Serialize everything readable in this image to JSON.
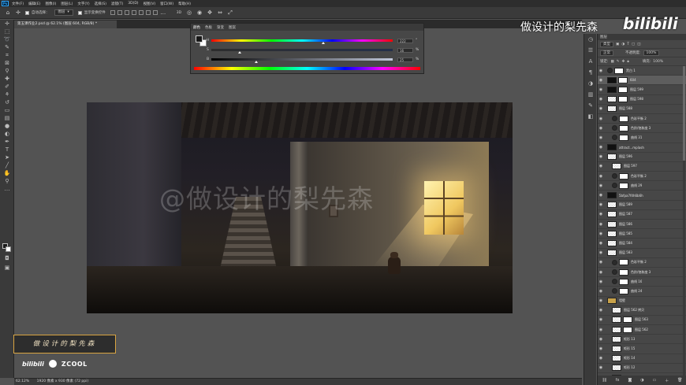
{
  "menubar": {
    "logo": "Ps",
    "items": [
      "文件(F)",
      "编辑(E)",
      "图像(I)",
      "图层(L)",
      "文字(Y)",
      "选择(S)",
      "滤镜(T)",
      "3D(D)",
      "视图(V)",
      "窗口(W)",
      "帮助(H)"
    ]
  },
  "options": {
    "auto_select_label": "自动选择：",
    "auto_select_value": "图层",
    "show_transform_label": "显示变换控件"
  },
  "document": {
    "tab_title": "第五课作业2.psd @ 62.1% (图层 604, RGB/8) *"
  },
  "color_panel": {
    "tabs": [
      "颜色",
      "色板",
      "渐变",
      "图案"
    ],
    "active_tab": "颜色",
    "channels": [
      {
        "label": "H",
        "value": "222",
        "unit": "°",
        "position": 0.62,
        "gradient": "linear-gradient(90deg,#f00,#ff0,#0f0,#0ff,#00f,#f0f,#f00)"
      },
      {
        "label": "S",
        "value": "16",
        "unit": "%",
        "position": 0.16,
        "gradient": "linear-gradient(90deg,#2d2d2d,#24304a)"
      },
      {
        "label": "B",
        "value": "25",
        "unit": "%",
        "position": 0.25,
        "gradient": "linear-gradient(90deg,#000,#bfc6d8)"
      }
    ]
  },
  "canvas": {
    "watermark": "@做设计的梨先森"
  },
  "badge": {
    "text": "做设计的梨先森",
    "bili": "bilibili",
    "zcool": "ZCOOL"
  },
  "status": {
    "zoom": "62.12%",
    "doc_size": "1920 像素 x 930 像素 (72 ppi)"
  },
  "overlay": {
    "author": "做设计的梨先森",
    "bilibili": "bilibili"
  },
  "layers_panel": {
    "tabs": [
      "图层"
    ],
    "filter_label": "类型",
    "mode": "正常",
    "opacity_label": "不透明度:",
    "opacity_value": "100%",
    "lock_label": "锁定:",
    "fill_label": "填充:",
    "fill_value": "100%",
    "layers": [
      {
        "name": "黑白 1",
        "type": "adj",
        "indent": false,
        "mask": true,
        "selected": false
      },
      {
        "name": "604",
        "type": "dark",
        "indent": false,
        "mask": true,
        "selected": true
      },
      {
        "name": "图层 599",
        "type": "dark",
        "indent": false,
        "mask": true,
        "selected": false
      },
      {
        "name": "图层 598",
        "type": "normal",
        "indent": false,
        "mask": true,
        "selected": false
      },
      {
        "name": "图层 588",
        "type": "normal",
        "indent": false,
        "mask": false,
        "selected": false
      },
      {
        "name": "色彩平衡 2",
        "type": "adj",
        "indent": true,
        "mask": true,
        "selected": false
      },
      {
        "name": "色阶/饱和度 3",
        "type": "adj",
        "indent": true,
        "mask": true,
        "selected": false
      },
      {
        "name": "曲线 31",
        "type": "adj",
        "indent": true,
        "mask": true,
        "selected": false
      },
      {
        "name": "attract...mplash",
        "type": "dark",
        "indent": false,
        "mask": false,
        "selected": false
      },
      {
        "name": "图层 596",
        "type": "normal",
        "indent": false,
        "mask": false,
        "selected": false
      },
      {
        "name": "图层 597",
        "type": "normal",
        "indent": true,
        "mask": false,
        "selected": false
      },
      {
        "name": "色彩平衡 2",
        "type": "adj",
        "indent": true,
        "mask": true,
        "selected": false
      },
      {
        "name": "曲线 29",
        "type": "adj",
        "indent": true,
        "mask": true,
        "selected": false
      },
      {
        "name": "5bfpa7f4h6b6h",
        "type": "dark",
        "indent": false,
        "mask": false,
        "selected": false
      },
      {
        "name": "图层 589",
        "type": "normal",
        "indent": false,
        "mask": false,
        "selected": false
      },
      {
        "name": "图层 587",
        "type": "normal",
        "indent": false,
        "mask": false,
        "selected": false
      },
      {
        "name": "图层 586",
        "type": "normal",
        "indent": false,
        "mask": false,
        "selected": false
      },
      {
        "name": "图层 585",
        "type": "normal",
        "indent": false,
        "mask": false,
        "selected": false
      },
      {
        "name": "图层 584",
        "type": "normal",
        "indent": false,
        "mask": false,
        "selected": false
      },
      {
        "name": "图层 583",
        "type": "normal",
        "indent": false,
        "mask": false,
        "selected": false
      },
      {
        "name": "色彩平衡 2",
        "type": "adj",
        "indent": true,
        "mask": true,
        "selected": false
      },
      {
        "name": "色阶/饱和度 3",
        "type": "adj",
        "indent": true,
        "mask": true,
        "selected": false
      },
      {
        "name": "曲线 16",
        "type": "adj",
        "indent": true,
        "mask": true,
        "selected": false
      },
      {
        "name": "曲线 24",
        "type": "adj",
        "indent": true,
        "mask": true,
        "selected": false
      },
      {
        "name": "墙壁",
        "type": "folder",
        "indent": false,
        "mask": false,
        "selected": false
      },
      {
        "name": "图层 562 拷贝",
        "type": "normal",
        "indent": true,
        "mask": false,
        "selected": false
      },
      {
        "name": "图层 563",
        "type": "normal",
        "indent": true,
        "mask": true,
        "selected": false
      },
      {
        "name": "图层 562",
        "type": "normal",
        "indent": true,
        "mask": true,
        "selected": false
      },
      {
        "name": "矩形 13",
        "type": "normal",
        "indent": true,
        "mask": false,
        "selected": false
      },
      {
        "name": "矩形 15",
        "type": "normal",
        "indent": true,
        "mask": false,
        "selected": false
      },
      {
        "name": "矩形 14",
        "type": "normal",
        "indent": true,
        "mask": false,
        "selected": false
      },
      {
        "name": "矩形 12",
        "type": "normal",
        "indent": true,
        "mask": false,
        "selected": false
      },
      {
        "name": "图层 592",
        "type": "normal",
        "indent": true,
        "mask": false,
        "selected": false
      }
    ]
  }
}
